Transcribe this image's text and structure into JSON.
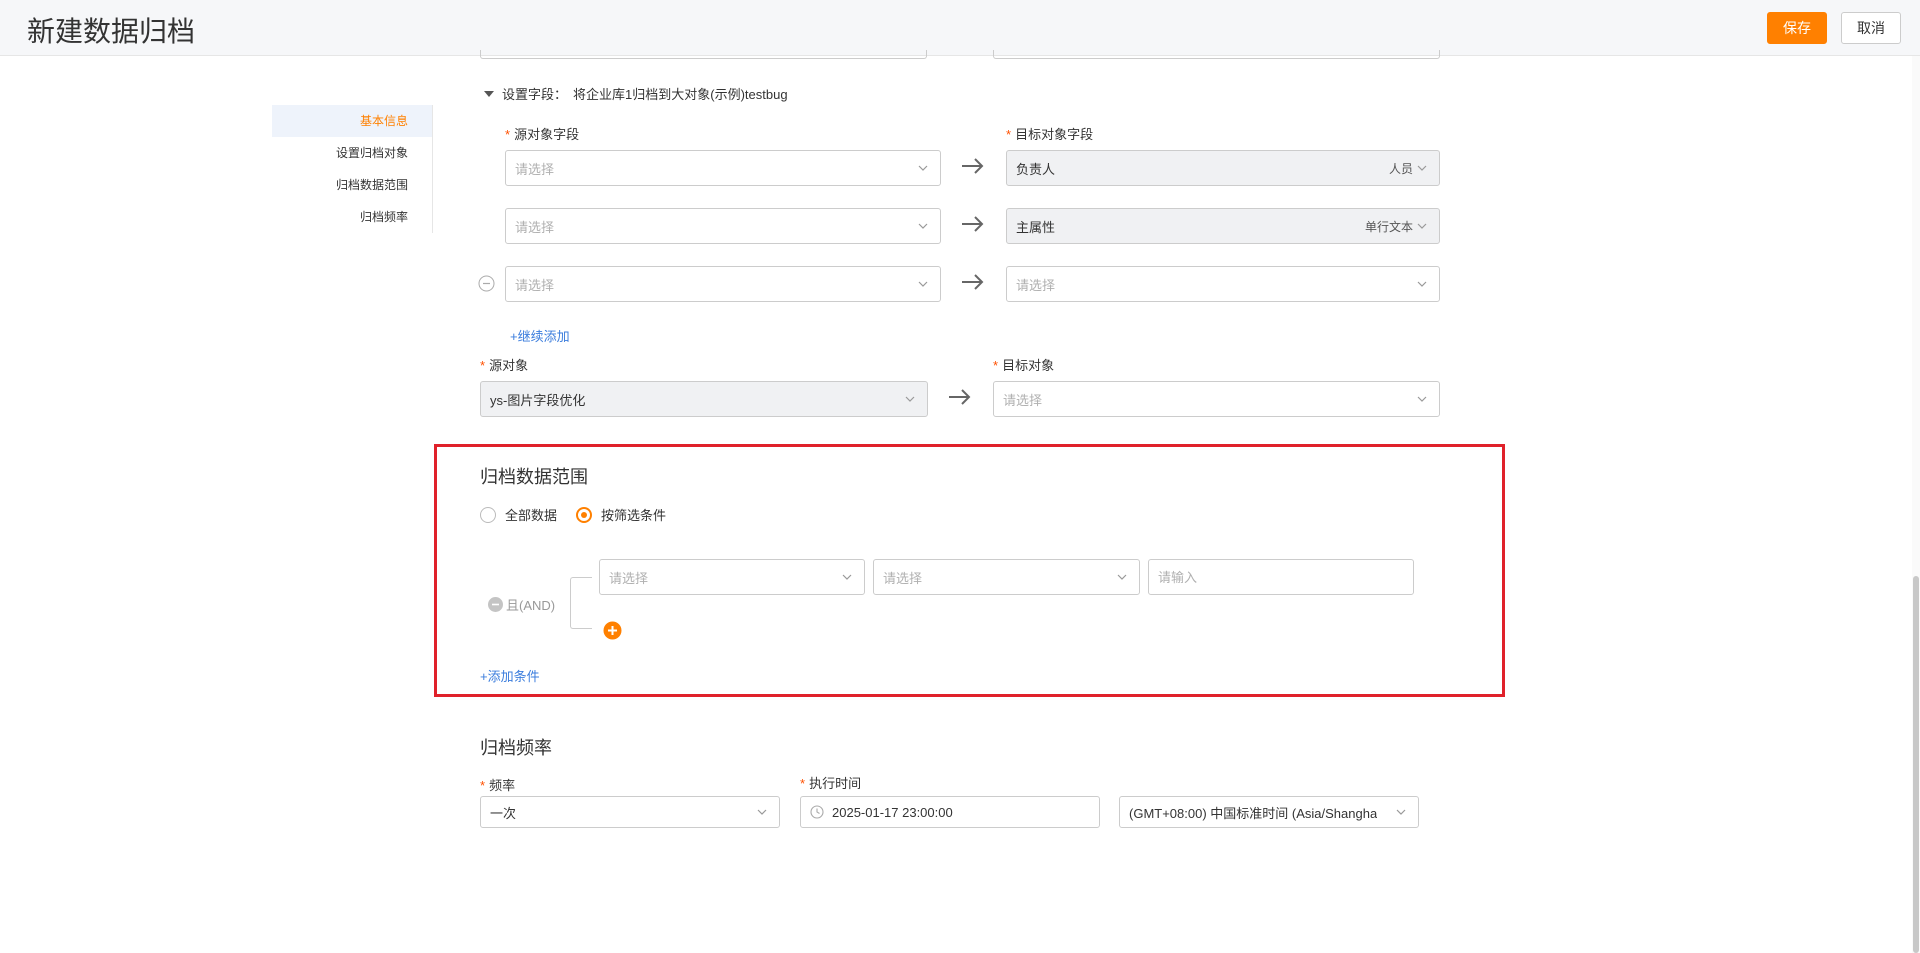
{
  "header": {
    "title": "新建数据归档",
    "save_label": "保存",
    "cancel_label": "取消"
  },
  "nav": {
    "items": [
      "基本信息",
      "设置归档对象",
      "归档数据范围",
      "归档频率"
    ]
  },
  "field_settings": {
    "title": "设置字段：",
    "subtitle": "将企业库1归档到大对象(示例)testbug",
    "source_label": "源对象字段",
    "target_label": "目标对象字段",
    "placeholder": "请选择",
    "rows": [
      {
        "target": "负责人",
        "target_type": "人员"
      },
      {
        "target": "主属性",
        "target_type": "单行文本"
      },
      {
        "target": "",
        "target_type": ""
      }
    ],
    "add_more": "+继续添加"
  },
  "objects": {
    "source_label": "源对象",
    "source_value": "ys-图片字段优化",
    "target_label": "目标对象",
    "target_placeholder": "请选择"
  },
  "range": {
    "title": "归档数据范围",
    "option_all": "全部数据",
    "option_filter": "按筛选条件",
    "logic": "且(AND)",
    "select_placeholder": "请选择",
    "input_placeholder": "请输入",
    "add_condition": "+添加条件"
  },
  "frequency": {
    "title": "归档频率",
    "freq_label": "频率",
    "freq_value": "一次",
    "time_label": "执行时间",
    "time_value": "2025-01-17 23:00:00",
    "timezone_value": "(GMT+08:00) 中国标准时间 (Asia/Shangha"
  },
  "colors": {
    "accent": "#ff8000",
    "link": "#3b7ddd",
    "highlight_border": "#e0212a"
  }
}
